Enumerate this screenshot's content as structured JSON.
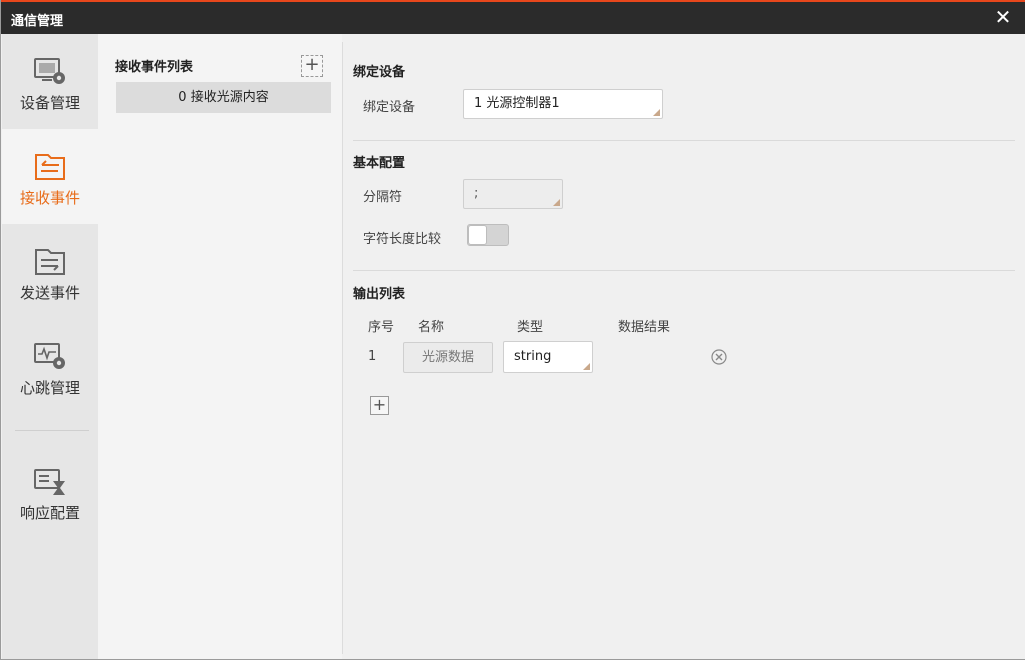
{
  "window": {
    "title": "通信管理",
    "close_glyph": "✕",
    "accent_color": "#e8471c"
  },
  "sidebar": {
    "items": [
      {
        "label": "设备管理",
        "icon": "device-gear-icon",
        "active": false
      },
      {
        "label": "接收事件",
        "icon": "receive-event-icon",
        "active": true
      },
      {
        "label": "发送事件",
        "icon": "send-event-icon",
        "active": false
      },
      {
        "label": "心跳管理",
        "icon": "heartbeat-gear-icon",
        "active": false
      },
      {
        "label": "响应配置",
        "icon": "response-hourglass-icon",
        "active": false
      }
    ],
    "active_color": "#e86c1a"
  },
  "event_list": {
    "title": "接收事件列表",
    "add_glyph": "+",
    "items": [
      {
        "label": "0 接收光源内容"
      }
    ]
  },
  "bind_section": {
    "title": "绑定设备",
    "device_label": "绑定设备",
    "device_value": "1 光源控制器1"
  },
  "basic_section": {
    "title": "基本配置",
    "separator_label": "分隔符",
    "separator_value": ";",
    "length_compare_label": "字符长度比较",
    "length_compare_on": false
  },
  "output_section": {
    "title": "输出列表",
    "columns": [
      "序号",
      "名称",
      "类型",
      "数据结果"
    ],
    "rows": [
      {
        "index": "1",
        "name": "光源数据",
        "type": "string",
        "result": ""
      }
    ],
    "add_glyph": "+"
  }
}
